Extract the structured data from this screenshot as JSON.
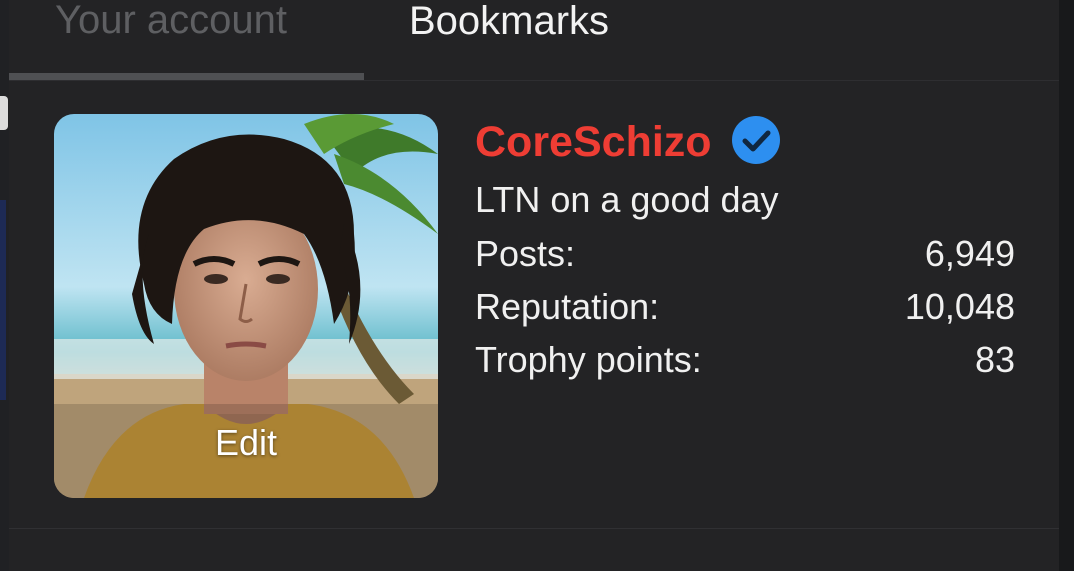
{
  "tabs": [
    {
      "label": "Your account",
      "active": false
    },
    {
      "label": "Bookmarks",
      "active": true
    }
  ],
  "profile": {
    "avatar_edit_label": "Edit",
    "username": "CoreSchizo",
    "username_color": "#ee3d34",
    "verified_icon": "check-badge-icon",
    "verified_color": "#2d8ff0",
    "user_title": "LTN on a good day",
    "stats": [
      {
        "label": "Posts:",
        "value": "6,949"
      },
      {
        "label": "Reputation:",
        "value": "10,048"
      },
      {
        "label": "Trophy points:",
        "value": "83"
      }
    ]
  }
}
